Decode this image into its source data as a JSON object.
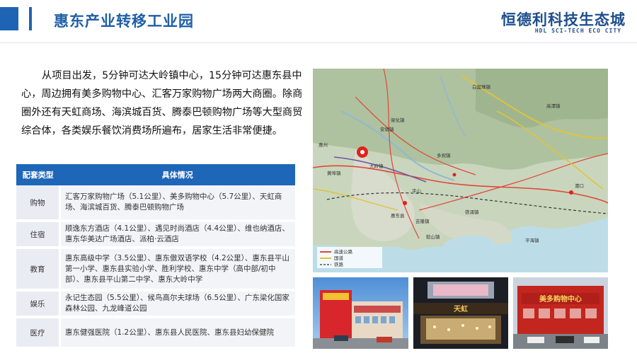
{
  "header": {
    "title": "惠东产业转移工业园",
    "brand_cn": "恒德利科技生态城",
    "brand_en": "HDL SCI-TECH ECO CITY"
  },
  "intro_text": "从项目出发，5分钟可达大岭镇中心，15分钟可达惠东县中心，周边拥有美多购物中心、汇客万家购物广场两大商圈。除商圈外还有天虹商场、海滨城百货、腾泰巴顿购物广场等大型商贸综合体，各类娱乐餐饮消费场所遍布，居家生活非常便捷。",
  "table": {
    "headers": [
      "配套类型",
      "具体情况"
    ],
    "rows": [
      {
        "category": "购物",
        "detail": "汇客万家购物广场（5.1公里）、美多购物中心（5.7公里）、天虹商场、海滨城百货、腾泰巴顿购物广场"
      },
      {
        "category": "住宿",
        "detail": "顺逸东方酒店（4.1公里）、遇见时尚酒店（4.4公里）、维也纳酒店、惠东华美达广场酒店、派柏·云酒店"
      },
      {
        "category": "教育",
        "detail": "惠东高级中学（3.5公里）、惠东傲双语学校（4.2公里）、惠东县平山第一小学、惠东县实验小学、胜利学校、惠东中学（高中部/初中部）、惠东县平山第二中学、惠东大岭中学"
      },
      {
        "category": "娱乐",
        "detail": "永记生态园（5.5公里）、候鸟高尔夫球场（6.5公里）、广东梁化国家森林公园、九龙峰道公园"
      },
      {
        "category": "医疗",
        "detail": "惠东健强医院（1.2公里）、惠东县人民医院、惠东县妇幼保健院"
      }
    ]
  },
  "map": {
    "labels": [
      "安墩镇",
      "白盆珠镇",
      "多祝镇",
      "高潭镇",
      "梁化镇",
      "大岭镇",
      "平山",
      "惠东县",
      "吉隆镇",
      "稔山镇",
      "黄埠镇",
      "铁涌镇",
      "平海镇",
      "港口",
      "惠州",
      "高速公路",
      "国道",
      "铁路"
    ]
  },
  "photos": {
    "photo2_sign": "天虹",
    "photo3_sign": "美多购物中心"
  },
  "colors": {
    "primary": "#1f64b4",
    "title": "#1f5fa8",
    "table_header": "#1e66b7",
    "cell_light": "#f2f4f7",
    "cell_cat": "#e9edf3"
  }
}
